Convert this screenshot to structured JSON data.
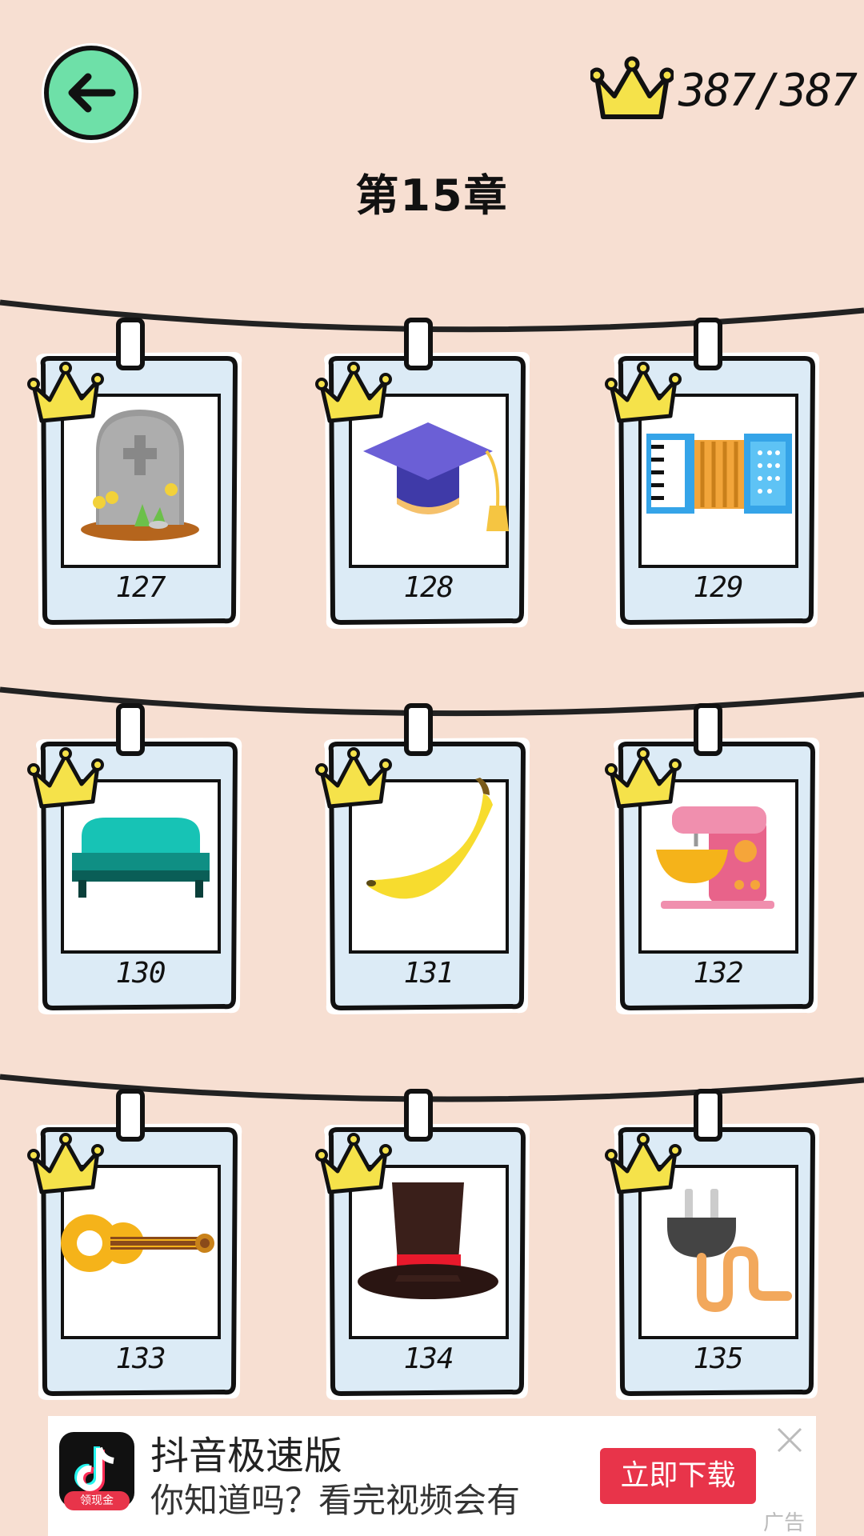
{
  "header": {
    "back_icon": "arrow-left-icon",
    "score_icon": "crown-icon",
    "score": "387/387",
    "chapter_title": "第15章"
  },
  "levels": [
    {
      "number": "127",
      "icon": "tombstone-icon",
      "completed": true
    },
    {
      "number": "128",
      "icon": "graduation-cap-icon",
      "completed": true
    },
    {
      "number": "129",
      "icon": "accordion-icon",
      "completed": true
    },
    {
      "number": "130",
      "icon": "sofa-icon",
      "completed": true
    },
    {
      "number": "131",
      "icon": "banana-icon",
      "completed": true
    },
    {
      "number": "132",
      "icon": "stand-mixer-icon",
      "completed": true
    },
    {
      "number": "133",
      "icon": "guitar-icon",
      "completed": true
    },
    {
      "number": "134",
      "icon": "top-hat-icon",
      "completed": true
    },
    {
      "number": "135",
      "icon": "plug-icon",
      "completed": true
    }
  ],
  "ad": {
    "app_icon": "douyin-icon",
    "badge": "领现金",
    "title": "抖音极速版",
    "description": "你知道吗？看完视频会有...",
    "download_label": "立即下载",
    "close_icon": "close-icon",
    "ad_label": "广告"
  },
  "colors": {
    "background": "#f7dfd2",
    "card": "#dcebf6",
    "crown": "#f5e24a",
    "back_button": "#6ee0a8",
    "ad_button": "#e8344a"
  }
}
